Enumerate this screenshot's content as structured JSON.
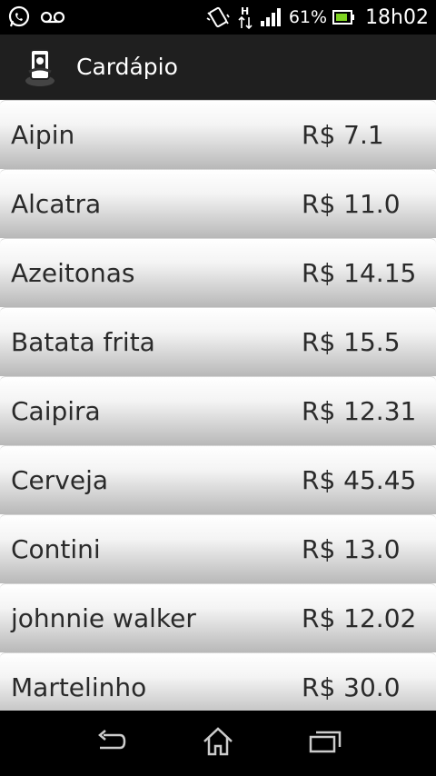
{
  "status_bar": {
    "left_icons": [
      "whatsapp-icon",
      "voicemail-icon"
    ],
    "right_icons": [
      "vibrate-icon",
      "data-h-icon",
      "signal-icon"
    ],
    "battery_percent": "61%",
    "time": "18h02"
  },
  "action_bar": {
    "title": "Cardápio",
    "icon": "app-logo-icon"
  },
  "menu": {
    "items": [
      {
        "name": "Aipin",
        "price": "R$ 7.1"
      },
      {
        "name": "Alcatra",
        "price": "R$ 11.0"
      },
      {
        "name": "Azeitonas",
        "price": "R$ 14.15"
      },
      {
        "name": "Batata frita",
        "price": "R$ 15.5"
      },
      {
        "name": "Caipira",
        "price": "R$ 12.31"
      },
      {
        "name": "Cerveja",
        "price": "R$ 45.45"
      },
      {
        "name": "Contini",
        "price": "R$ 13.0"
      },
      {
        "name": "johnnie walker",
        "price": "R$ 12.02"
      },
      {
        "name": "Martelinho",
        "price": "R$ 30.0"
      }
    ]
  },
  "nav_bar": {
    "buttons": [
      "back-icon",
      "home-icon",
      "recent-apps-icon"
    ]
  },
  "colors": {
    "status_bar_bg": "#000000",
    "action_bar_bg": "#1f1f1f",
    "row_text": "#2a2a2a",
    "battery_green": "#7fd321"
  }
}
